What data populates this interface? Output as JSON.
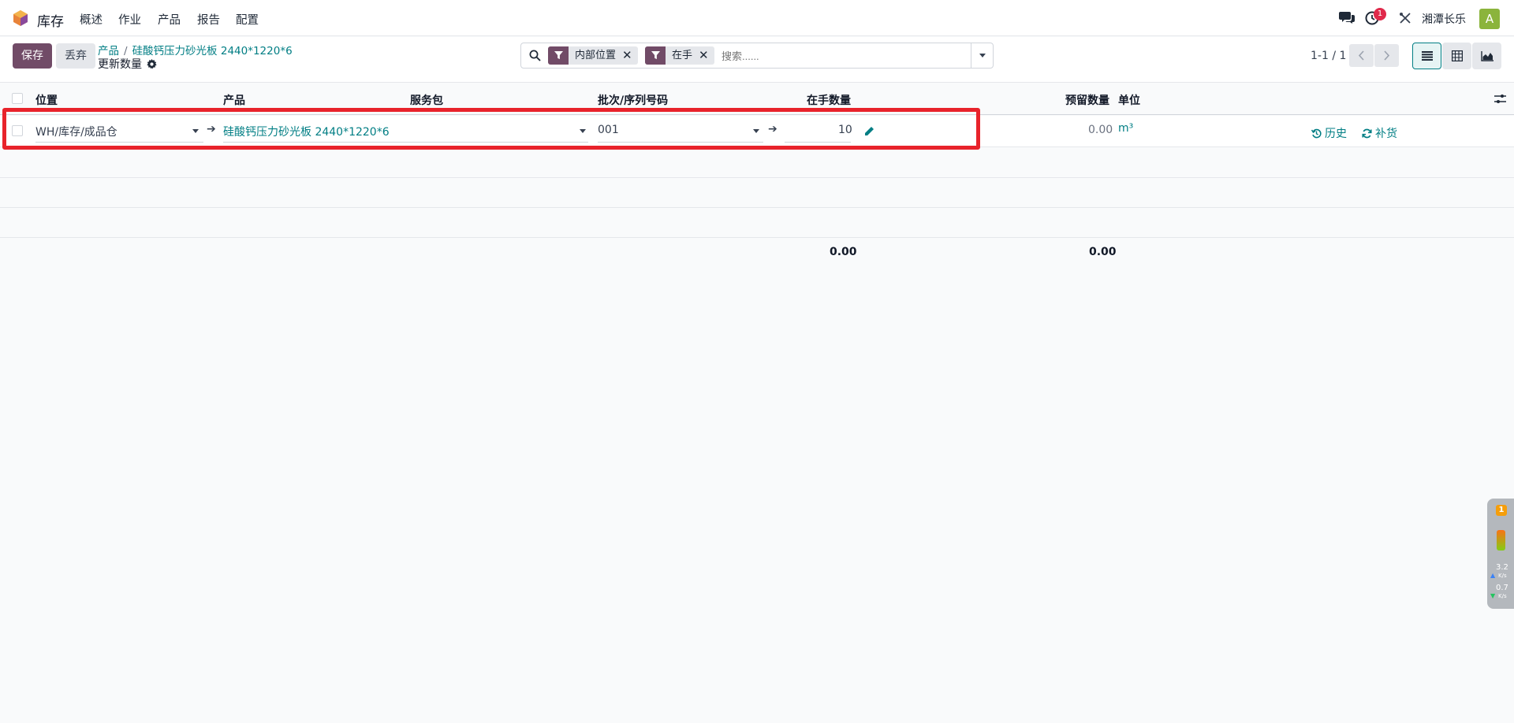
{
  "navbar": {
    "app_name": "库存",
    "menu": [
      "概述",
      "作业",
      "产品",
      "报告",
      "配置"
    ],
    "activity_count": "1",
    "company": "湘潭长乐",
    "avatar_letter": "A"
  },
  "control": {
    "save_label": "保存",
    "discard_label": "丢弃",
    "breadcrumb_parent": "产品",
    "breadcrumb_sep": "/",
    "breadcrumb_current": "硅酸钙压力砂光板 2440*1220*6",
    "subtitle": "更新数量",
    "search": {
      "facets": [
        "内部位置",
        "在手"
      ],
      "placeholder": "搜索......"
    },
    "pager": "1-1 / 1"
  },
  "table": {
    "columns": {
      "location": "位置",
      "product": "产品",
      "package": "服务包",
      "lot": "批次/序列号码",
      "on_hand": "在手数量",
      "reserved": "预留数量",
      "uom": "单位"
    },
    "row": {
      "location": "WH/库存/成品仓",
      "product": "硅酸钙压力砂光板 2440*1220*6",
      "package": "",
      "lot": "001",
      "on_hand": "10",
      "reserved": "0.00",
      "uom": "m³",
      "history_label": "历史",
      "replenish_label": "补货"
    },
    "totals": {
      "on_hand": "0.00",
      "reserved": "0.00"
    }
  },
  "side_widget": {
    "badge": "1",
    "up_speed": "3.2",
    "up_unit": "K/s",
    "down_speed": "0.7",
    "down_unit": "K/s"
  },
  "colors": {
    "brand": "#714b67",
    "link": "#017e84",
    "highlight": "#e8232b"
  }
}
